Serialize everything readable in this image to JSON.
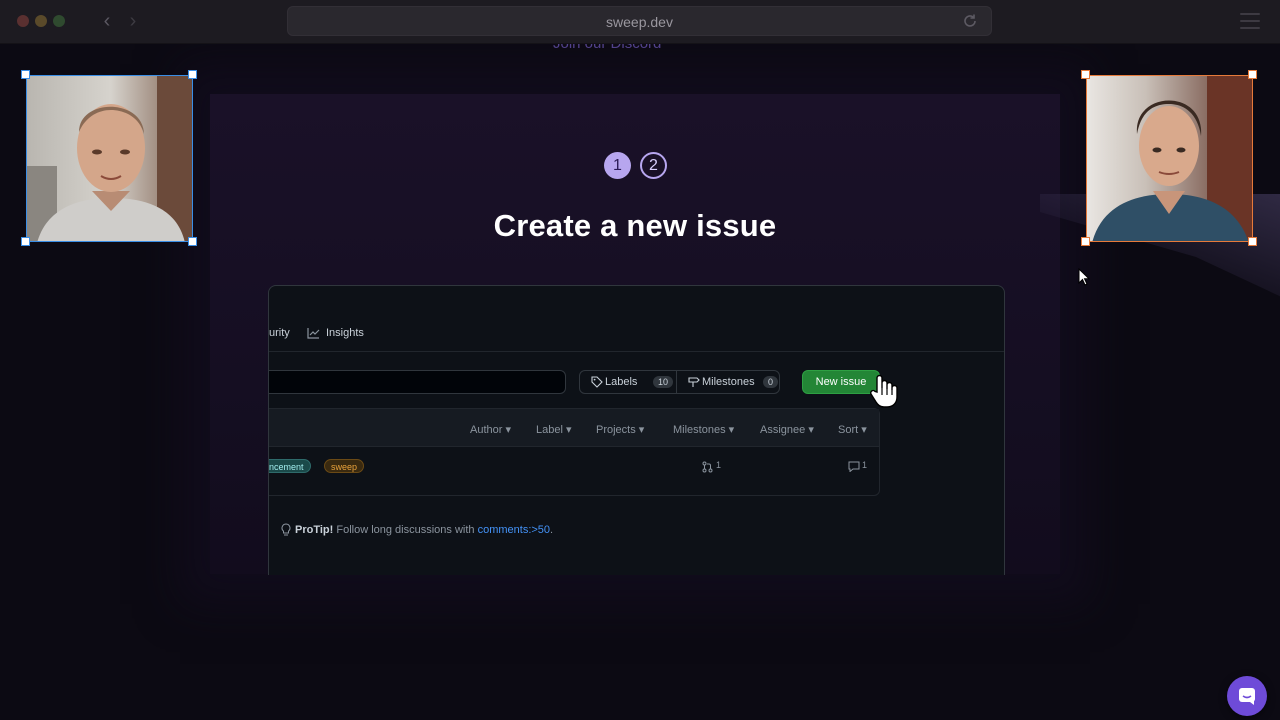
{
  "browser": {
    "url": "sweep.dev"
  },
  "page": {
    "discord_link": "Join our Discord",
    "steps": [
      "1",
      "2"
    ],
    "headline": "Create a new issue"
  },
  "github": {
    "tabs": {
      "security_partial": "urity",
      "insights": "Insights"
    },
    "labels_button": {
      "label": "Labels",
      "count": "10"
    },
    "milestones_button": {
      "label": "Milestones",
      "count": "0"
    },
    "new_issue_button": "New issue",
    "filters": [
      "Author",
      "Label",
      "Projects",
      "Milestones",
      "Assignee",
      "Sort"
    ],
    "issue_row": {
      "labels": [
        {
          "text": "hancement",
          "color": "#a2eeef"
        },
        {
          "text": "sweep",
          "color": "#e9a23b"
        }
      ],
      "linked_prs": "1",
      "comments": "1"
    },
    "protip": {
      "strong": "ProTip!",
      "text": " Follow long discussions with ",
      "link": "comments:>50",
      "end": "."
    }
  },
  "colors": {
    "accent_purple": "#b7a6ef",
    "new_issue_green": "#238636",
    "chat_button": "#6e4bd8",
    "left_cam_border": "#3a8ee6",
    "right_cam_border": "#e67a3a"
  }
}
